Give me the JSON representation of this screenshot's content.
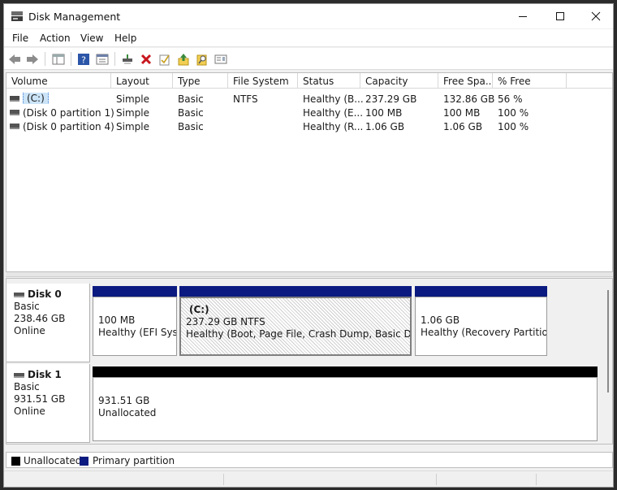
{
  "window": {
    "title": "Disk Management"
  },
  "menu": [
    "File",
    "Action",
    "View",
    "Help"
  ],
  "toolbar": {
    "icons": [
      "back-icon",
      "forward-icon",
      "show-hide-console-tree-icon",
      "help-icon",
      "properties-icon",
      "connect-drive-icon",
      "delete-icon",
      "check-icon",
      "import-icon",
      "search-icon",
      "view-icon"
    ]
  },
  "volume_list": {
    "columns": [
      "Volume",
      "Layout",
      "Type",
      "File System",
      "Status",
      "Capacity",
      "Free Spa...",
      "% Free"
    ],
    "rows": [
      {
        "volume": "(C:)",
        "layout": "Simple",
        "type": "Basic",
        "fs": "NTFS",
        "status": "Healthy (B...",
        "capacity": "237.29 GB",
        "free": "132.86 GB",
        "pct": "56 %"
      },
      {
        "volume": "(Disk 0 partition 1)",
        "layout": "Simple",
        "type": "Basic",
        "fs": "",
        "status": "Healthy (E...",
        "capacity": "100 MB",
        "free": "100 MB",
        "pct": "100 %"
      },
      {
        "volume": "(Disk 0 partition 4)",
        "layout": "Simple",
        "type": "Basic",
        "fs": "",
        "status": "Healthy (R...",
        "capacity": "1.06 GB",
        "free": "1.06 GB",
        "pct": "100 %"
      }
    ]
  },
  "disks": [
    {
      "name": "Disk 0",
      "type": "Basic",
      "size": "238.46 GB",
      "state": "Online",
      "partitions": [
        {
          "title": "",
          "size": "100 MB",
          "status": "Healthy (EFI Syste"
        },
        {
          "title": "(C:)",
          "size": "237.29 GB NTFS",
          "status": "Healthy (Boot, Page File, Crash Dump, Basic Data Pa"
        },
        {
          "title": "",
          "size": "1.06 GB",
          "status": "Healthy (Recovery Partition)"
        }
      ]
    },
    {
      "name": "Disk 1",
      "type": "Basic",
      "size": "931.51 GB",
      "state": "Online",
      "partitions": [
        {
          "title": "",
          "size": "931.51 GB",
          "status": "Unallocated"
        }
      ]
    }
  ],
  "legend": [
    {
      "label": "Unallocated",
      "color": "#000000"
    },
    {
      "label": "Primary partition",
      "color": "#0a1a80"
    }
  ],
  "colors": {
    "primary": "#0a1a80",
    "unallocated": "#000000",
    "selection": "#cce4f7"
  }
}
